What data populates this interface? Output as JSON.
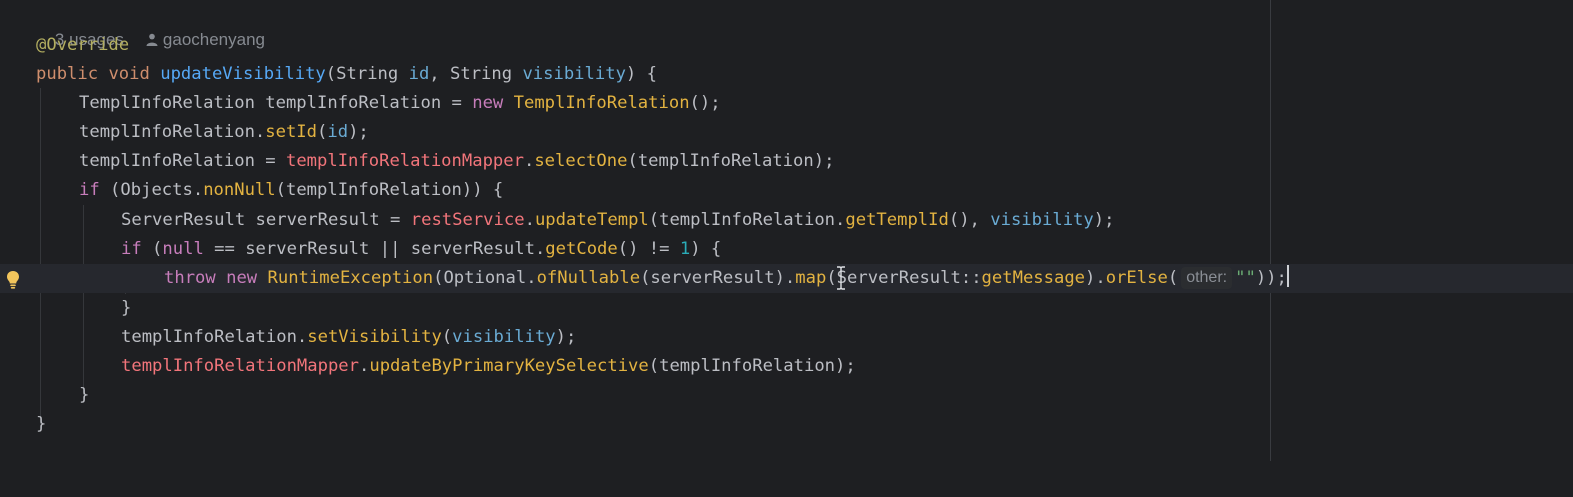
{
  "editor": {
    "usages_label": "3 usages",
    "author_label": "gaochenyang",
    "inlay_param_hint": "other:",
    "lines": {
      "l1": [
        "@Override"
      ],
      "l2": [
        "public",
        "void",
        "updateVisibility",
        "(String ",
        "id",
        ", String ",
        "visibility",
        ") {"
      ],
      "l3": [
        "TemplInfoRelation templInfoRelation = ",
        "new",
        "TemplInfoRelation",
        "();"
      ],
      "l4": [
        "templInfoRelation.",
        "setId",
        "(",
        "id",
        ");"
      ],
      "l5": [
        "templInfoRelation = ",
        "templInfoRelationMapper",
        ".",
        "selectOne",
        "(templInfoRelation);"
      ],
      "l6": [
        "if",
        " (Objects.",
        "nonNull",
        "(templInfoRelation)) {"
      ],
      "l7": [
        "ServerResult serverResult = ",
        "restService",
        ".",
        "updateTempl",
        "(templInfoRelation.",
        "getTemplId",
        "(), ",
        "visibility",
        ");"
      ],
      "l8": [
        "if",
        " (",
        "null",
        " == serverResult || serverResult.",
        "getCode",
        "() != ",
        "1",
        ") {"
      ],
      "l9": [
        "throw",
        "new",
        "RuntimeException",
        "(Optional.",
        "ofNullable",
        "(serverResult).",
        "map",
        "(ServerResult::",
        "getMessage",
        ").",
        "orElse",
        "(",
        "\"\"",
        "));"
      ],
      "l10": [
        "}"
      ],
      "l11": [
        "templInfoRelation.",
        "setVisibility",
        "(",
        "visibility",
        ");"
      ],
      "l12": [
        "templInfoRelationMapper",
        ".",
        "updateByPrimaryKeySelective",
        "(templInfoRelation);"
      ],
      "l13": [
        "}"
      ],
      "l14": [
        "}"
      ]
    }
  },
  "colors": {
    "background": "#1e1f22",
    "keyword": "#cf8e6d",
    "annotation": "#b3ae60",
    "method": "#e8ba36",
    "field": "#f2757b",
    "parameter": "#6aabd4",
    "number": "#2aacb8",
    "string": "#6aab73"
  },
  "icons": {
    "gutter": "lightbulb-icon",
    "author": "person-icon",
    "cursor": "text-cursor-icon"
  }
}
